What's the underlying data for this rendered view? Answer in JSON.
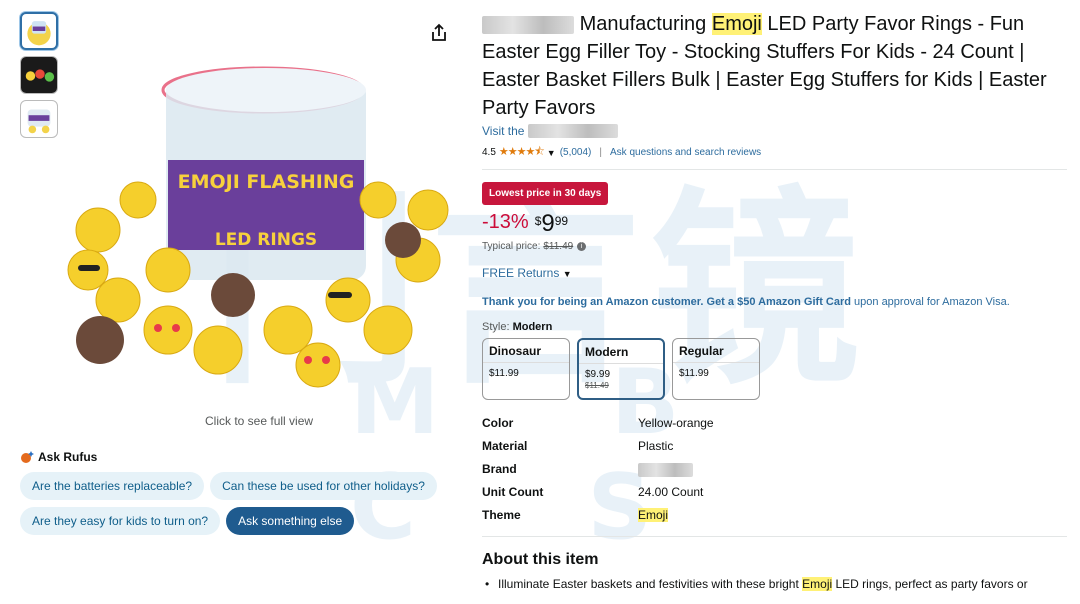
{
  "gallery": {
    "thumbnails": [
      "thumb-bucket",
      "thumb-rings-lit",
      "thumb-bucket-alt"
    ],
    "click_to_view": "Click to see full view",
    "product_image_text_1": "EMOJI FLASHING",
    "product_image_text_2": "LED RINGS"
  },
  "rufus": {
    "title": "Ask Rufus",
    "chips": [
      "Are the batteries replaceable?",
      "Can these be used for other holidays?",
      "Are they easy for kids to turn on?"
    ],
    "ask_button": "Ask something else"
  },
  "product": {
    "title_before": "Manufacturing ",
    "title_highlight": "Emoji",
    "title_after": " LED Party Favor Rings - Fun Easter Egg Filler Toy - Stocking Stuffers For Kids - 24 Count | Easter Basket Fillers Bulk | Easter Egg Stuffers for Kids | Easter Party Favors",
    "visit": "Visit the",
    "rating": "4.5",
    "rating_value": 4.5,
    "review_count": "(5,004)",
    "ask_link": "Ask questions and search reviews",
    "deal_badge": "Lowest price in 30 days",
    "discount": "-13%",
    "currency": "$",
    "price_whole": "9",
    "price_fraction": "99",
    "typical_label": "Typical price:",
    "typical_price": "$11.49",
    "returns": "FREE Returns",
    "promo_bold": "Thank you for being an Amazon customer. Get a $50 Amazon Gift Card",
    "promo_rest": " upon approval for Amazon Visa."
  },
  "style": {
    "label": "Style:",
    "selected": "Modern",
    "options": [
      {
        "name": "Dinosaur",
        "price": "$11.99",
        "old": ""
      },
      {
        "name": "Modern",
        "price": "$9.99",
        "old": "$11.49"
      },
      {
        "name": "Regular",
        "price": "$11.99",
        "old": ""
      }
    ]
  },
  "specs": [
    {
      "key": "Color",
      "value": "Yellow-orange"
    },
    {
      "key": "Material",
      "value": "Plastic"
    },
    {
      "key": "Brand",
      "value": ""
    },
    {
      "key": "Unit Count",
      "value": "24.00 Count"
    },
    {
      "key": "Theme",
      "value": "Emoji"
    }
  ],
  "about": {
    "title": "About this item",
    "bullet_before": "Illuminate Easter baskets and festivities with these bright ",
    "bullet_highlight": "Emoji",
    "bullet_after": " LED rings, perfect as party favors or"
  },
  "colors": {
    "link": "#2d6c9e",
    "deal": "#c7163c",
    "discount": "#cc0c39",
    "rufus_button": "#1f5b8f",
    "highlight": "#fff176"
  },
  "icons": {
    "share": "share-icon",
    "rufus": "rufus-sparkle-icon",
    "chevron": "chevron-down-icon",
    "info": "info-icon"
  },
  "watermark": {
    "cn": "门言镜",
    "en": "M B C S"
  }
}
